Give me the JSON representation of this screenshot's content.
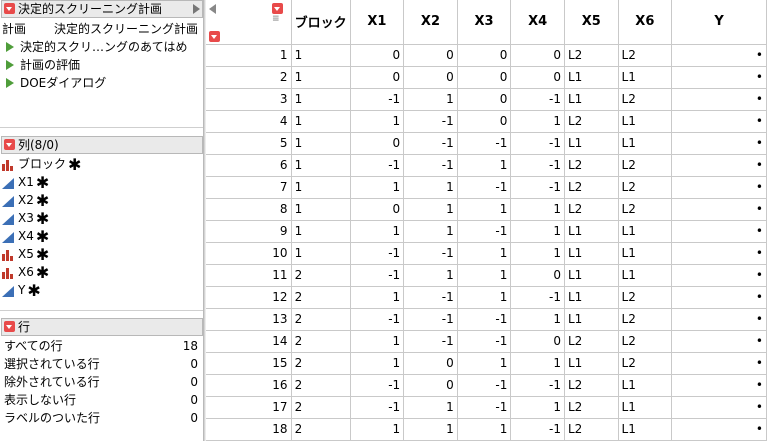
{
  "panel_design": {
    "title": "決定的スクリーニング計画",
    "row_label": "計画",
    "row_value": "決定的スクリーニング計画",
    "scripts": [
      "決定的スクリ…ングのあてはめ",
      "計画の評価",
      "DOEダイアログ"
    ]
  },
  "panel_columns": {
    "title": "列(8/0)",
    "items": [
      {
        "name": "ブロック",
        "type": "nominal"
      },
      {
        "name": "X1",
        "type": "continuous"
      },
      {
        "name": "X2",
        "type": "continuous"
      },
      {
        "name": "X3",
        "type": "continuous"
      },
      {
        "name": "X4",
        "type": "continuous"
      },
      {
        "name": "X5",
        "type": "nominal"
      },
      {
        "name": "X6",
        "type": "nominal"
      },
      {
        "name": "Y",
        "type": "continuous"
      }
    ],
    "star": "✱"
  },
  "panel_rows": {
    "title": "行",
    "items": [
      {
        "label": "すべての行",
        "value": "18"
      },
      {
        "label": "選択されている行",
        "value": "0"
      },
      {
        "label": "除外されている行",
        "value": "0"
      },
      {
        "label": "表示しない行",
        "value": "0"
      },
      {
        "label": "ラベルのついた行",
        "value": "0"
      }
    ]
  },
  "table": {
    "headers": [
      "ブロック",
      "X1",
      "X2",
      "X3",
      "X4",
      "X5",
      "X6",
      "Y"
    ],
    "rows": [
      [
        "1",
        "1",
        "0",
        "0",
        "0",
        "0",
        "L2",
        "L2",
        "•"
      ],
      [
        "2",
        "1",
        "0",
        "0",
        "0",
        "0",
        "L1",
        "L1",
        "•"
      ],
      [
        "3",
        "1",
        "-1",
        "1",
        "0",
        "-1",
        "L1",
        "L2",
        "•"
      ],
      [
        "4",
        "1",
        "1",
        "-1",
        "0",
        "1",
        "L2",
        "L1",
        "•"
      ],
      [
        "5",
        "1",
        "0",
        "-1",
        "-1",
        "-1",
        "L1",
        "L1",
        "•"
      ],
      [
        "6",
        "1",
        "-1",
        "-1",
        "1",
        "-1",
        "L2",
        "L2",
        "•"
      ],
      [
        "7",
        "1",
        "1",
        "1",
        "-1",
        "-1",
        "L2",
        "L2",
        "•"
      ],
      [
        "8",
        "1",
        "0",
        "1",
        "1",
        "1",
        "L2",
        "L2",
        "•"
      ],
      [
        "9",
        "1",
        "1",
        "1",
        "-1",
        "1",
        "L1",
        "L1",
        "•"
      ],
      [
        "10",
        "1",
        "-1",
        "-1",
        "1",
        "1",
        "L1",
        "L1",
        "•"
      ],
      [
        "11",
        "2",
        "-1",
        "1",
        "1",
        "0",
        "L1",
        "L1",
        "•"
      ],
      [
        "12",
        "2",
        "1",
        "-1",
        "1",
        "-1",
        "L1",
        "L2",
        "•"
      ],
      [
        "13",
        "2",
        "-1",
        "-1",
        "-1",
        "1",
        "L1",
        "L2",
        "•"
      ],
      [
        "14",
        "2",
        "1",
        "-1",
        "-1",
        "0",
        "L2",
        "L2",
        "•"
      ],
      [
        "15",
        "2",
        "1",
        "0",
        "1",
        "1",
        "L1",
        "L2",
        "•"
      ],
      [
        "16",
        "2",
        "-1",
        "0",
        "-1",
        "-1",
        "L2",
        "L1",
        "•"
      ],
      [
        "17",
        "2",
        "-1",
        "1",
        "-1",
        "1",
        "L2",
        "L1",
        "•"
      ],
      [
        "18",
        "2",
        "1",
        "1",
        "1",
        "-1",
        "L2",
        "L1",
        "•"
      ]
    ]
  },
  "colors": {
    "red_menu": "#e84a4a",
    "green_script": "#4f9d3a",
    "continuous_icon": "#3b6fb6",
    "nominal_icon": "#c0392b"
  }
}
